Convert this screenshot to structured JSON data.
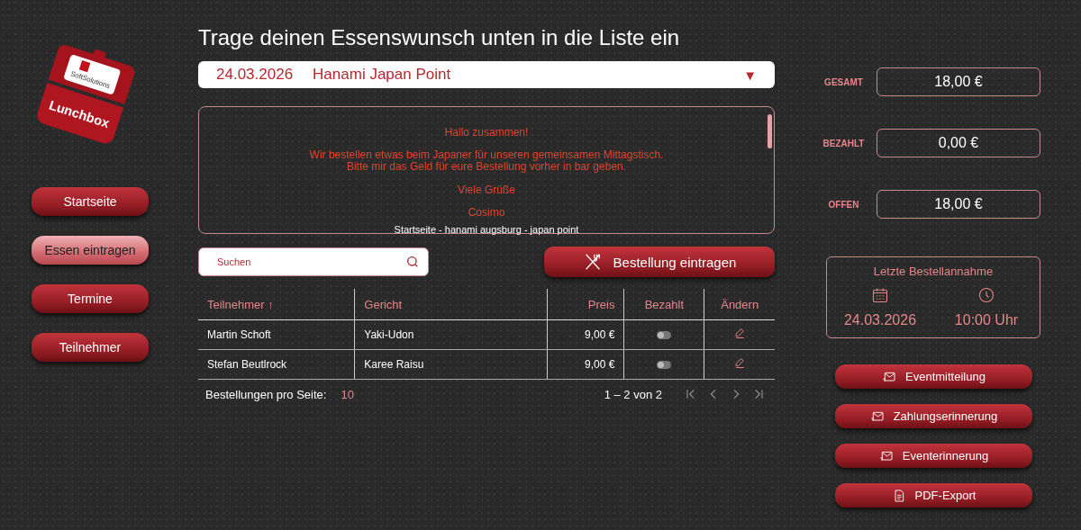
{
  "logo": {
    "brand": "SoftSolutions",
    "title": "Lunchbox"
  },
  "nav": [
    {
      "label": "Startseite",
      "selected": false
    },
    {
      "label": "Essen eintragen",
      "selected": true
    },
    {
      "label": "Termine",
      "selected": false
    },
    {
      "label": "Teilnehmer",
      "selected": false
    }
  ],
  "heading": "Trage deinen Essenswunsch unten in die Liste ein",
  "event_select": {
    "date": "24.03.2026",
    "restaurant": "Hanami Japan Point",
    "caret": "▼"
  },
  "message": [
    "Hallo zusammen!",
    "Wir bestellen etwas beim Japaner für unseren gemeinsamen Mittagstisch.\nBitte mir das Geld für eure Bestellung vorher in bar geben.",
    "Viele Grüße",
    "Cosimo",
    "Startseite - hanami augsburg - japan point"
  ],
  "search": {
    "placeholder": "Suchen"
  },
  "order_button": "Bestellung eintragen",
  "table": {
    "columns": [
      {
        "label": "Teilnehmer",
        "sort": "↑"
      },
      {
        "label": "Gericht"
      },
      {
        "label": "Preis"
      },
      {
        "label": "Bezahlt"
      },
      {
        "label": "Ändern"
      }
    ],
    "rows": [
      {
        "name": "Martin Schoft",
        "dish": "Yaki-Udon",
        "price": "9,00 €",
        "paid": false
      },
      {
        "name": "Stefan Beutlrock",
        "dish": "Karee Raisu",
        "price": "9,00 €",
        "paid": false
      }
    ]
  },
  "paginator": {
    "label": "Bestellungen pro Seite:",
    "page_size": "10",
    "range": "1 – 2 von 2"
  },
  "totals": [
    {
      "label": "GESAMT",
      "value": "18,00 €"
    },
    {
      "label": "BEZAHLT",
      "value": "0,00 €"
    },
    {
      "label": "OFFEN",
      "value": "18,00 €"
    }
  ],
  "deadline": {
    "title": "Letzte Bestellannahme",
    "date": "24.03.2026",
    "time": "10:00 Uhr"
  },
  "actions": [
    {
      "label": "Eventmitteilung",
      "kind": "mail"
    },
    {
      "label": "Zahlungserinnerung",
      "kind": "mail"
    },
    {
      "label": "Eventerinnerung",
      "kind": "mail"
    },
    {
      "label": "PDF-Export",
      "kind": "pdf"
    }
  ]
}
